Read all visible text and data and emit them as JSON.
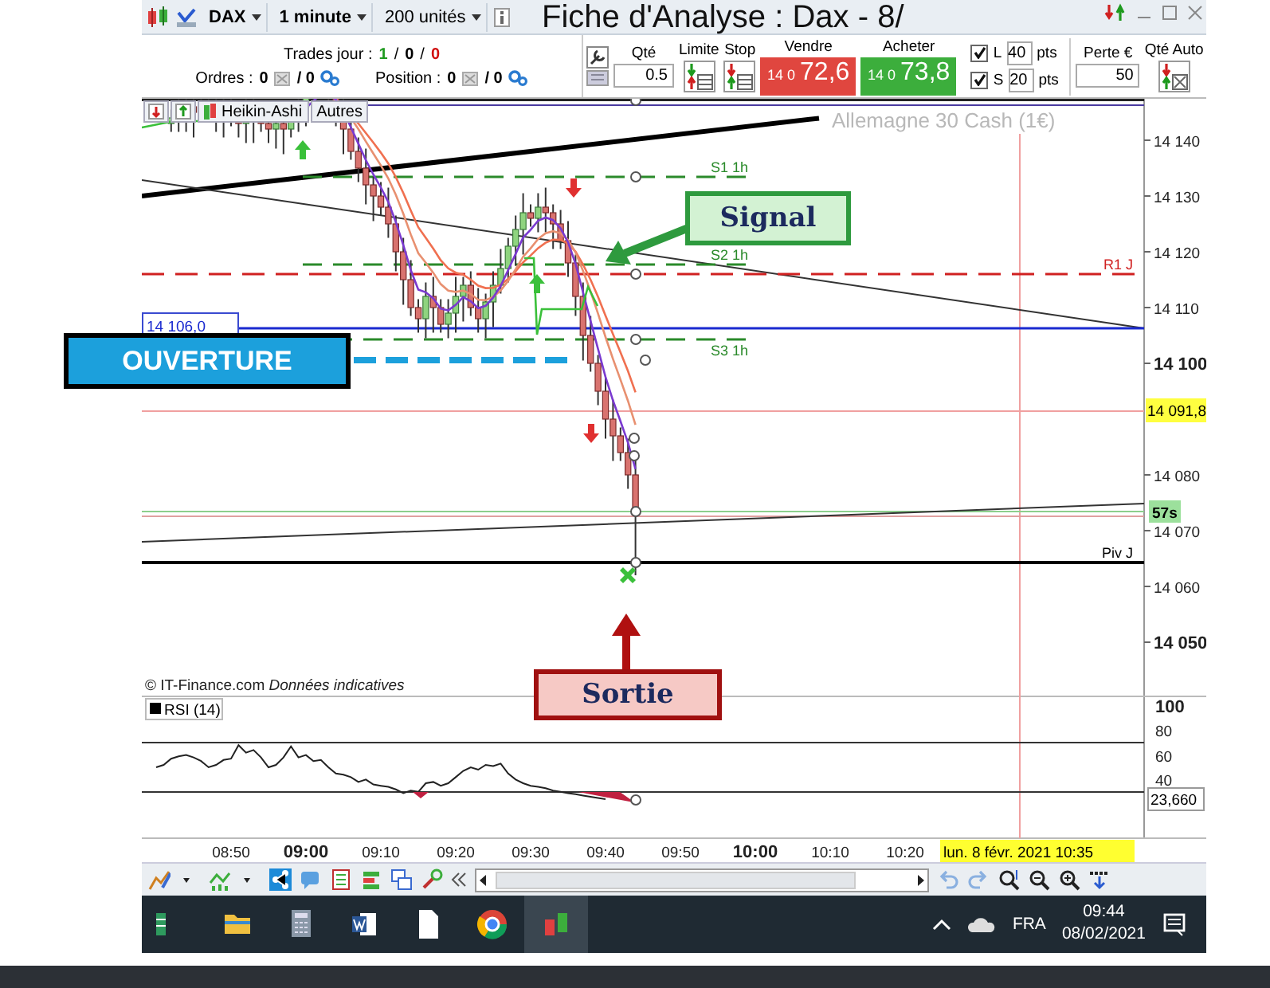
{
  "page_title": "Fiche d'Analyse : Dax - 8/",
  "toolbar": {
    "symbol": "DAX",
    "timeframe": "1 minute",
    "quantity": "200 unités"
  },
  "order_panel": {
    "trades_label": "Trades jour :",
    "trades": [
      {
        "value": "1",
        "color": "#1e9a1e"
      },
      {
        "value": "0",
        "color": "#000000"
      },
      {
        "value": "0",
        "color": "#d01010"
      }
    ],
    "trades_separators": [
      "/",
      "/"
    ],
    "orders_label": "Ordres :",
    "orders_value": "0",
    "orders_pending": "/ 0",
    "position_label": "Position :",
    "position_value": "0",
    "position_pending": "/ 0"
  },
  "ticket": {
    "qty_label": "Qté",
    "qty": "0.5",
    "limit_label": "Limite",
    "stop_label": "Stop",
    "sell_label": "Vendre",
    "sell_prefix": "14 0",
    "sell_price": "72,6",
    "buy_label": "Acheter",
    "buy_prefix": "14 0",
    "buy_price": "73,8",
    "brackets": [
      {
        "label": "L",
        "checked": true,
        "value": "40",
        "unit": "pts"
      },
      {
        "label": "S",
        "checked": true,
        "value": "20",
        "unit": "pts"
      }
    ],
    "loss_label": "Perte €",
    "loss": "50",
    "auto_label": "Qté Auto"
  },
  "chart": {
    "tabs": [
      "Heikin-Ashi",
      "Autres"
    ],
    "watermark": "Allemagne 30 Cash (1€)",
    "price_ticks": [
      {
        "label": "14 140",
        "major": false
      },
      {
        "label": "14 130",
        "major": false
      },
      {
        "label": "14 120",
        "major": false
      },
      {
        "label": "14 110",
        "major": false
      },
      {
        "label": "14 100",
        "major": true
      },
      {
        "label": "14 080",
        "major": false
      },
      {
        "label": "14 070",
        "major": false
      },
      {
        "label": "14 060",
        "major": false
      },
      {
        "label": "14 050",
        "major": true
      }
    ],
    "level_labels": [
      "S1 1h",
      "S2 1h",
      "S3 1h",
      "R1 J",
      "Piv J"
    ],
    "open_tag": "14 106,0",
    "last_price_tag": "14 091,8",
    "countdown_tag": "57s",
    "copyright": "© IT-Finance.com *Données indicatives*",
    "rsi": {
      "label": "RSI (14)",
      "ticks": [
        "100",
        "80",
        "60",
        "40"
      ],
      "value": "23,660"
    },
    "time_ticks": [
      {
        "label": "08:50",
        "major": false
      },
      {
        "label": "09:00",
        "major": true
      },
      {
        "label": "09:10",
        "major": false
      },
      {
        "label": "09:20",
        "major": false
      },
      {
        "label": "09:30",
        "major": false
      },
      {
        "label": "09:40",
        "major": false
      },
      {
        "label": "09:50",
        "major": false
      },
      {
        "label": "10:00",
        "major": true
      },
      {
        "label": "10:10",
        "major": false
      },
      {
        "label": "10:20",
        "major": false
      }
    ],
    "cursor_date": "lun. 8 févr. 2021 10:35"
  },
  "annotations": [
    {
      "kind": "signal",
      "text": "Signal"
    },
    {
      "kind": "open",
      "text": "OUVERTURE"
    },
    {
      "kind": "exit",
      "text": "Sortie"
    }
  ],
  "taskbar": {
    "language": "FRA",
    "time": "09:44",
    "date": "08/02/2021"
  }
}
